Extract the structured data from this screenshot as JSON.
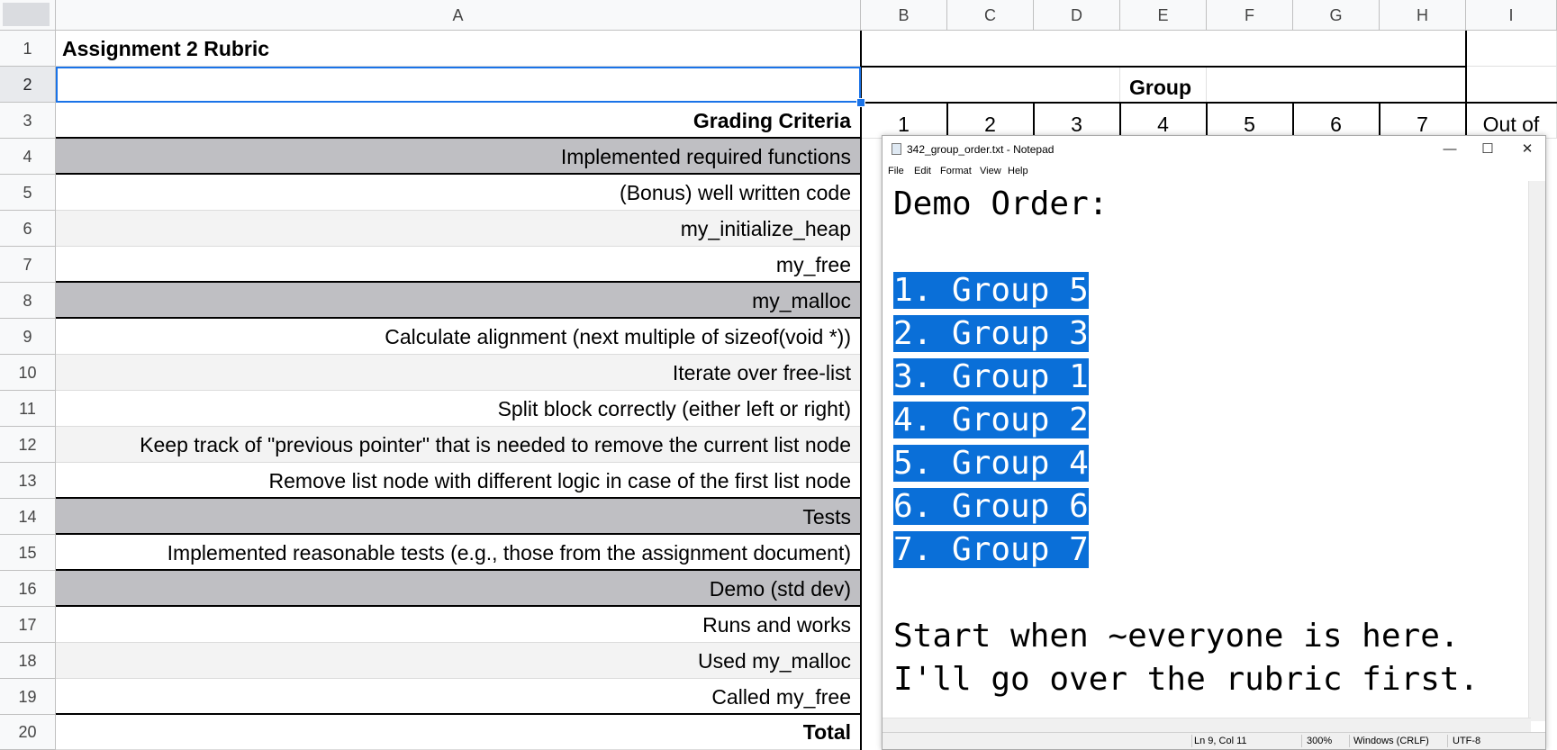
{
  "columns": [
    "A",
    "B",
    "C",
    "D",
    "E",
    "F",
    "G",
    "H",
    "I"
  ],
  "rows": [
    {
      "num": "1",
      "text": "Assignment 2 Rubric"
    },
    {
      "num": "2",
      "text": ""
    },
    {
      "num": "3",
      "text": "Grading Criteria"
    },
    {
      "num": "4",
      "text": "Implemented required functions"
    },
    {
      "num": "5",
      "text": "(Bonus) well written code"
    },
    {
      "num": "6",
      "text": "my_initialize_heap"
    },
    {
      "num": "7",
      "text": "my_free"
    },
    {
      "num": "8",
      "text": "my_malloc"
    },
    {
      "num": "9",
      "text": "Calculate alignment (next multiple of sizeof(void *))"
    },
    {
      "num": "10",
      "text": "Iterate over free-list"
    },
    {
      "num": "11",
      "text": "Split block correctly (either left or right)"
    },
    {
      "num": "12",
      "text": "Keep track of \"previous pointer\" that is needed to remove the current list node"
    },
    {
      "num": "13",
      "text": "Remove list node with different logic in case of the first list node"
    },
    {
      "num": "14",
      "text": "Tests"
    },
    {
      "num": "15",
      "text": "Implemented reasonable tests (e.g., those from the assignment document)"
    },
    {
      "num": "16",
      "text": "Demo (std dev)"
    },
    {
      "num": "17",
      "text": "Runs and works"
    },
    {
      "num": "18",
      "text": "Used my_malloc"
    },
    {
      "num": "19",
      "text": "Called my_free"
    },
    {
      "num": "20",
      "text": "Total"
    }
  ],
  "group_header": "Group",
  "group_numbers": [
    "1",
    "2",
    "3",
    "4",
    "5",
    "6",
    "7"
  ],
  "out_of": "Out of",
  "notepad": {
    "title": "342_group_order.txt - Notepad",
    "menu": [
      "File",
      "Edit",
      "Format",
      "View",
      "Help"
    ],
    "heading": "Demo Order:",
    "order": [
      "1. Group 5",
      "2. Group 3",
      "3. Group 1",
      "4. Group 2",
      "5. Group 4",
      "6. Group 6",
      "7. Group 7"
    ],
    "footer1": "Start when ~everyone is here.",
    "footer2": "I'll go over the rubric first.",
    "status": {
      "pos": "Ln 9, Col 11",
      "zoom": "300%",
      "eol": "Windows (CRLF)",
      "enc": "UTF-8"
    }
  },
  "colors": {
    "highlight": "#0a6fd8",
    "selection": "#1a73e8",
    "gray_row": "#bfbfc3"
  }
}
